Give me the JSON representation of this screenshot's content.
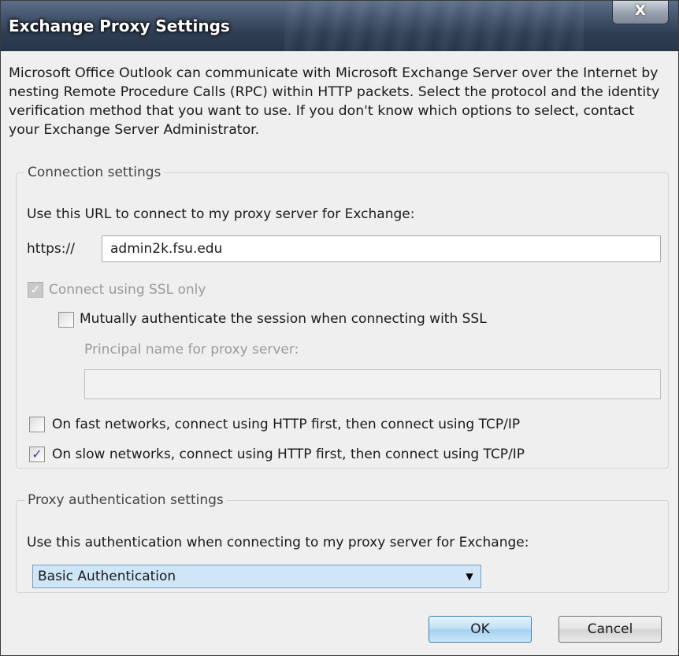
{
  "window": {
    "title": "Exchange Proxy Settings",
    "close_label": "X"
  },
  "description": "Microsoft Office Outlook can communicate with Microsoft Exchange Server over the Internet by nesting Remote Procedure Calls (RPC) within HTTP packets.  Select the protocol and the identity verification method that you want to use.  If you don't know which options to select, contact your Exchange Server Administrator.",
  "connection": {
    "legend": "Connection settings",
    "url_label": "Use this URL to connect to my proxy server for Exchange:",
    "url_prefix": "https://",
    "url_value": "admin2k.fsu.edu",
    "ssl_only": {
      "label": "Connect using SSL only",
      "checked": true,
      "disabled": true
    },
    "mutual_auth": {
      "label": "Mutually authenticate the session when connecting with SSL",
      "checked": false
    },
    "principal_label": "Principal name for proxy server:",
    "principal_value": "",
    "fast_networks": {
      "label": "On fast networks, connect using HTTP first, then connect using TCP/IP",
      "checked": false
    },
    "slow_networks": {
      "label": "On slow networks, connect using HTTP first, then connect using TCP/IP",
      "checked": true
    }
  },
  "proxy_auth": {
    "legend": "Proxy authentication settings",
    "label": "Use this authentication when connecting to my proxy server for Exchange:",
    "selected": "Basic Authentication"
  },
  "buttons": {
    "ok": "OK",
    "cancel": "Cancel"
  },
  "colors": {
    "title_bar": "#3a4a60",
    "selection": "#cfe6f7",
    "ok_border": "#3c7fb1"
  }
}
